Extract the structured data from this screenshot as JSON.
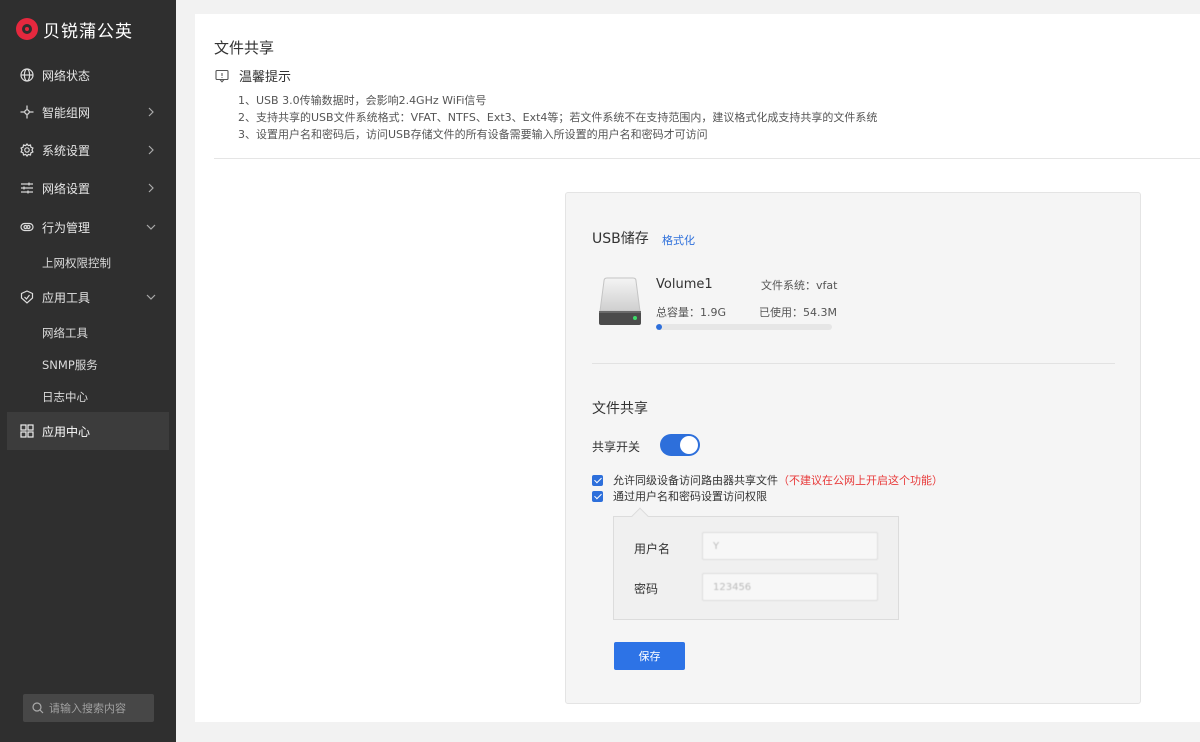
{
  "brand": {
    "name": "贝锐蒲公英"
  },
  "sidebar": {
    "items": [
      {
        "label": "网络状态",
        "icon": "globe-icon"
      },
      {
        "label": "智能组网",
        "icon": "network-icon"
      },
      {
        "label": "系统设置",
        "icon": "gear-icon"
      },
      {
        "label": "网络设置",
        "icon": "sliders-icon"
      },
      {
        "label": "行为管理",
        "icon": "behavior-icon"
      },
      {
        "label": "应用工具",
        "icon": "shield-icon"
      },
      {
        "label": "应用中心",
        "icon": "apps-icon"
      }
    ],
    "subitems": {
      "behavior": [
        "上网权限控制"
      ],
      "tools": [
        "网络工具",
        "SNMP服务",
        "日志中心"
      ]
    },
    "search_placeholder": "请输入搜索内容"
  },
  "page": {
    "title": "文件共享",
    "tip_title": "温馨提示",
    "tips": [
      "1、USB 3.0传输数据时，会影响2.4GHz WiFi信号",
      "2、支持共享的USB文件系统格式：VFAT、NTFS、Ext3、Ext4等；若文件系统不在支持范围内，建议格式化成支持共享的文件系统",
      "3、设置用户名和密码后，访问USB存储文件的所有设备需要输入所设置的用户名和密码才可访问"
    ]
  },
  "usb": {
    "title": "USB储存",
    "format_link": "格式化",
    "volume_name": "Volume1",
    "filesystem": "文件系统：vfat",
    "total": "总容量：1.9G",
    "used": "已使用：54.3M",
    "used_fraction": 0.028
  },
  "share": {
    "title": "文件共享",
    "switch_label": "共享开关",
    "switch_on": true,
    "allow_peer": "允许同级设备访问路由器共享文件",
    "allow_peer_warning": "（不建议在公网上开启这个功能）",
    "auth_label": "通过用户名和密码设置访问权限",
    "username_label": "用户名",
    "username_value": "Y",
    "password_label": "密码",
    "password_value": "123456",
    "save_label": "保存"
  },
  "colors": {
    "accent": "#2d6fdb",
    "warning": "#e83a3a",
    "sidebar": "#2f2f2f",
    "brand": "#e5283e"
  }
}
